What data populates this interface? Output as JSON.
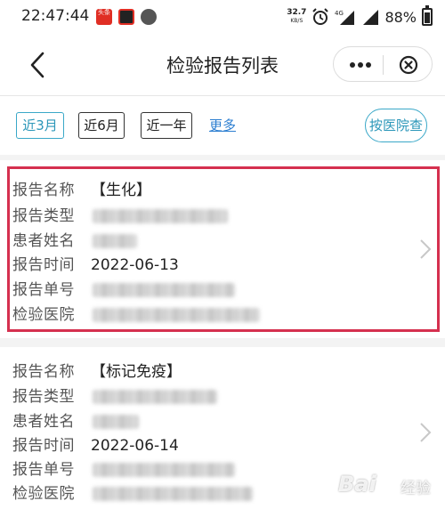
{
  "status_bar": {
    "time": "22:47:44",
    "toutiao_badge": "头条",
    "net_speed_value": "32.7",
    "net_speed_unit": "KB/S",
    "signal_label": "4G",
    "battery_percent": "88%"
  },
  "nav": {
    "title": "检验报告列表"
  },
  "filters": {
    "chips": [
      "近3月",
      "近6月",
      "近一年"
    ],
    "active_index": 0,
    "more_label": "更多",
    "hospital_button": "按医院查"
  },
  "reports": [
    {
      "labels": [
        "报告名称",
        "报告类型",
        "患者姓名",
        "报告时间",
        "报告单号",
        "检验医院"
      ],
      "name": "【生化】",
      "time": "2022-06-13",
      "highlighted": true
    },
    {
      "labels": [
        "报告名称",
        "报告类型",
        "患者姓名",
        "报告时间",
        "报告单号",
        "检验医院"
      ],
      "name": "【标记免疫】",
      "time": "2022-06-14",
      "highlighted": false
    }
  ],
  "watermark": {
    "brand": "Bai",
    "sub": "经验"
  },
  "colors": {
    "accent": "#2c97b9",
    "link": "#2d7fd1",
    "highlight_border": "#d5304f"
  }
}
